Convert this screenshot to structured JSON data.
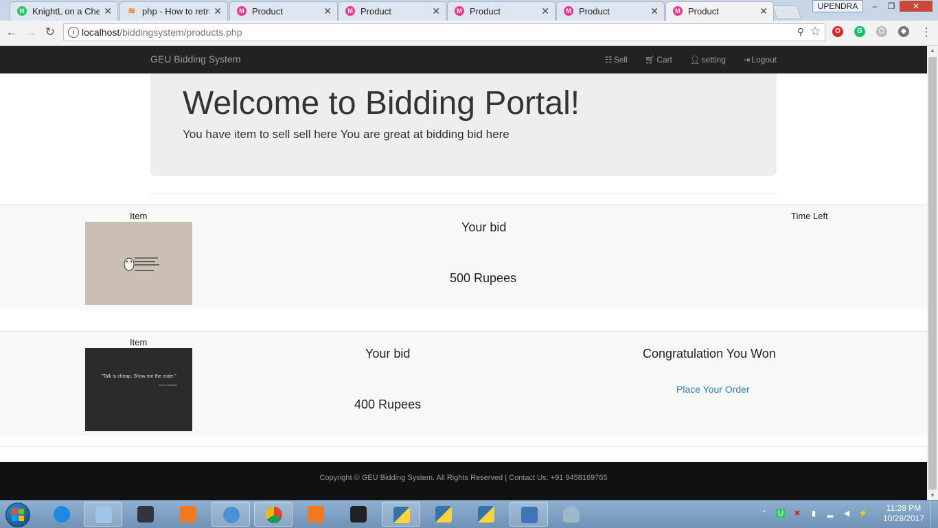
{
  "browser": {
    "tabs": [
      {
        "title": "KnightL on a Ches",
        "favicon": "hackerrank-icon",
        "color": "#2ec866"
      },
      {
        "title": "php - How to retrie",
        "favicon": "stackoverflow-icon",
        "color": "#f48024"
      },
      {
        "title": "Product",
        "favicon": "product-icon",
        "color": "#e8388f"
      },
      {
        "title": "Product",
        "favicon": "product-icon",
        "color": "#e8388f"
      },
      {
        "title": "Product",
        "favicon": "product-icon",
        "color": "#e8388f"
      },
      {
        "title": "Product",
        "favicon": "product-icon",
        "color": "#e8388f"
      },
      {
        "title": "Product",
        "favicon": "product-icon",
        "color": "#e8388f",
        "active": true
      }
    ],
    "profile_name": "UPENDRA",
    "url_host": "localhost",
    "url_path": "/biddingsystem/products.php"
  },
  "site": {
    "brand": "GEU Bidding System",
    "nav": {
      "sell": "Sell",
      "cart": "Cart",
      "setting": "setting",
      "logout": "Logout"
    },
    "jumbotron": {
      "heading": "Welcome to Bidding Portal!",
      "text": "You have item to sell sell here You are great at bidding bid here"
    },
    "bids": [
      {
        "item_label": "Item",
        "bid_label": "Your bid",
        "amount": "500 Rupees",
        "time_label": "Time Left",
        "thumb_bg": "#cbbfb3"
      },
      {
        "item_label": "Item",
        "bid_label": "Your bid",
        "amount": "400 Rupees",
        "status": "Congratulation You Won",
        "action": "Place Your Order",
        "thumb_bg": "#2b2b2b",
        "thumb_quote": "\"Talk is cheap. Show me the code.\"",
        "thumb_author": "Linus Torvalds"
      }
    ],
    "footer": "Copyright © GEU Bidding System. All Rights Reserved | Contact Us: +91 9458169765"
  },
  "taskbar": {
    "time": "11:28 PM",
    "date": "10/28/2017"
  }
}
